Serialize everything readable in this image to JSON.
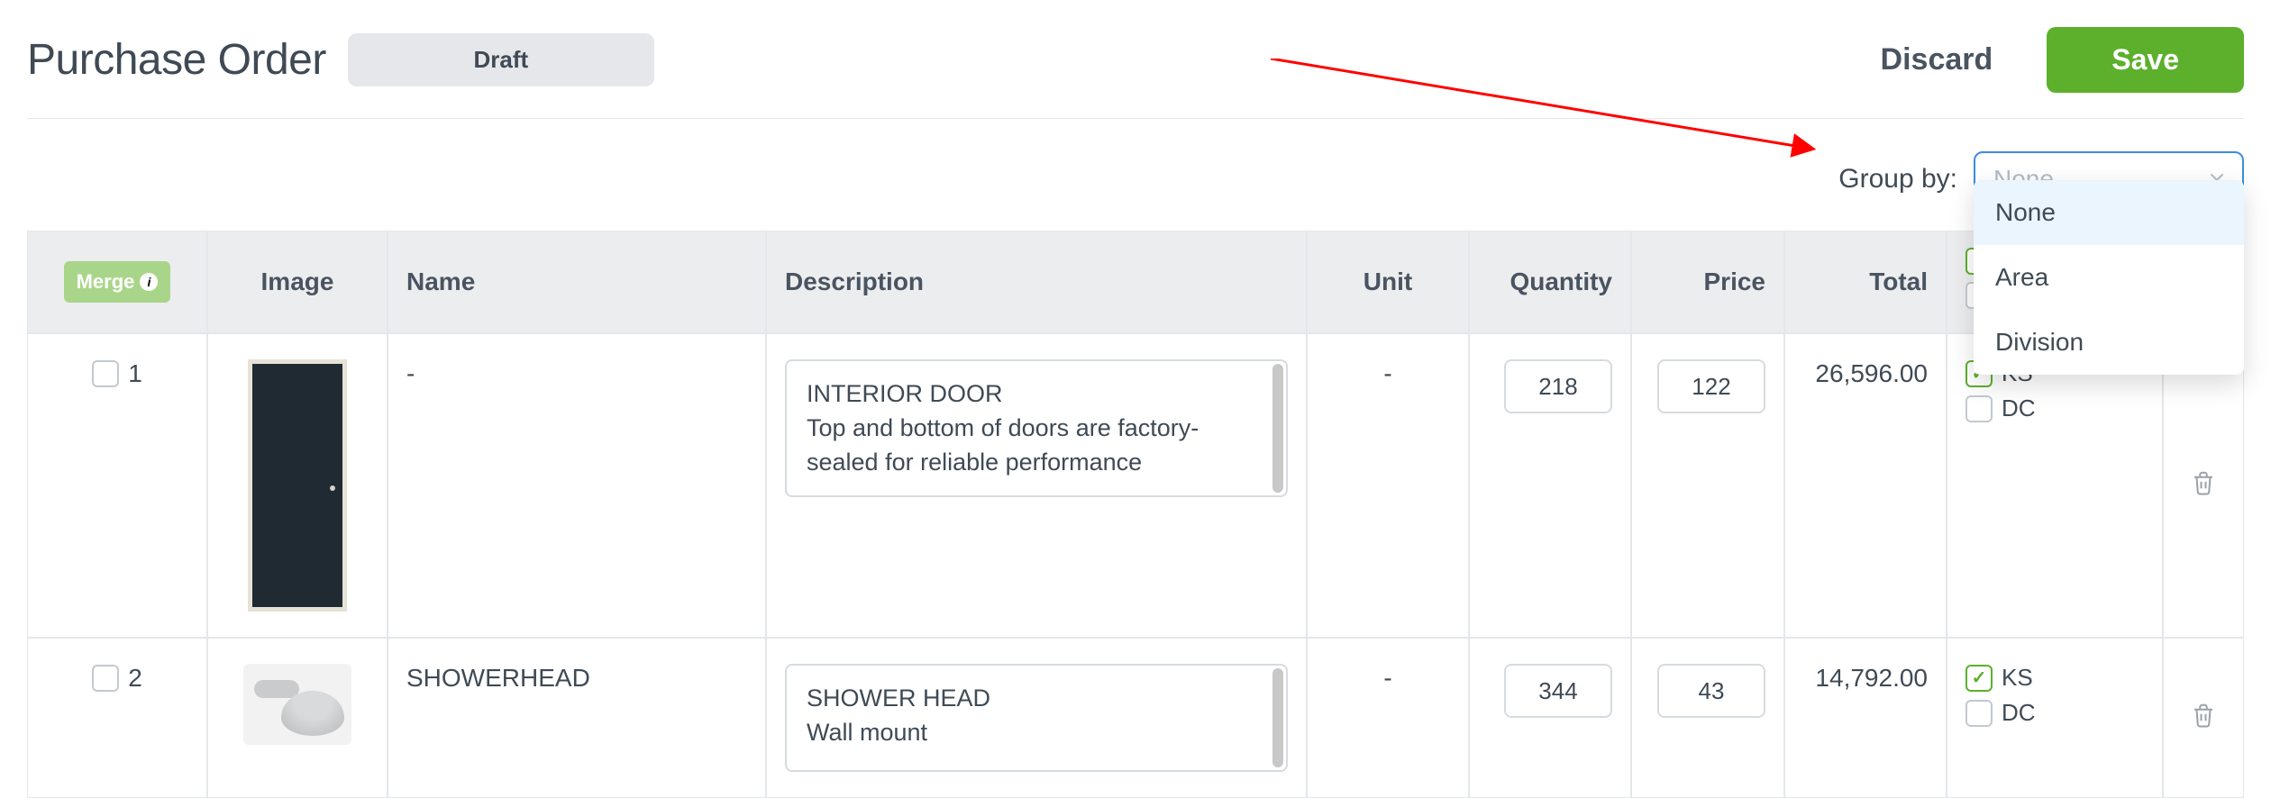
{
  "header": {
    "title": "Purchase Order",
    "status": "Draft",
    "discard": "Discard",
    "save": "Save"
  },
  "group_by": {
    "label": "Group by:",
    "value": "None",
    "options": [
      "None",
      "Area",
      "Division"
    ]
  },
  "columns": {
    "merge": "Merge",
    "image": "Image",
    "name": "Name",
    "description": "Description",
    "unit": "Unit",
    "quantity": "Quantity",
    "price": "Price",
    "total": "Total"
  },
  "rows": [
    {
      "index": "1",
      "name": "-",
      "desc_title": "INTERIOR DOOR",
      "desc_body": "Top and bottom of doors are factory-sealed for reliable performance",
      "unit": "-",
      "quantity": "218",
      "price": "122",
      "total": "26,596.00",
      "tags": [
        {
          "label": "KS",
          "checked": true
        },
        {
          "label": "DC",
          "checked": false
        }
      ]
    },
    {
      "index": "2",
      "name": "SHOWERHEAD",
      "desc_title": "SHOWER HEAD",
      "desc_body": "Wall mount",
      "unit": "-",
      "quantity": "344",
      "price": "43",
      "total": "14,792.00",
      "tags": [
        {
          "label": "KS",
          "checked": true
        },
        {
          "label": "DC",
          "checked": false
        }
      ]
    }
  ]
}
